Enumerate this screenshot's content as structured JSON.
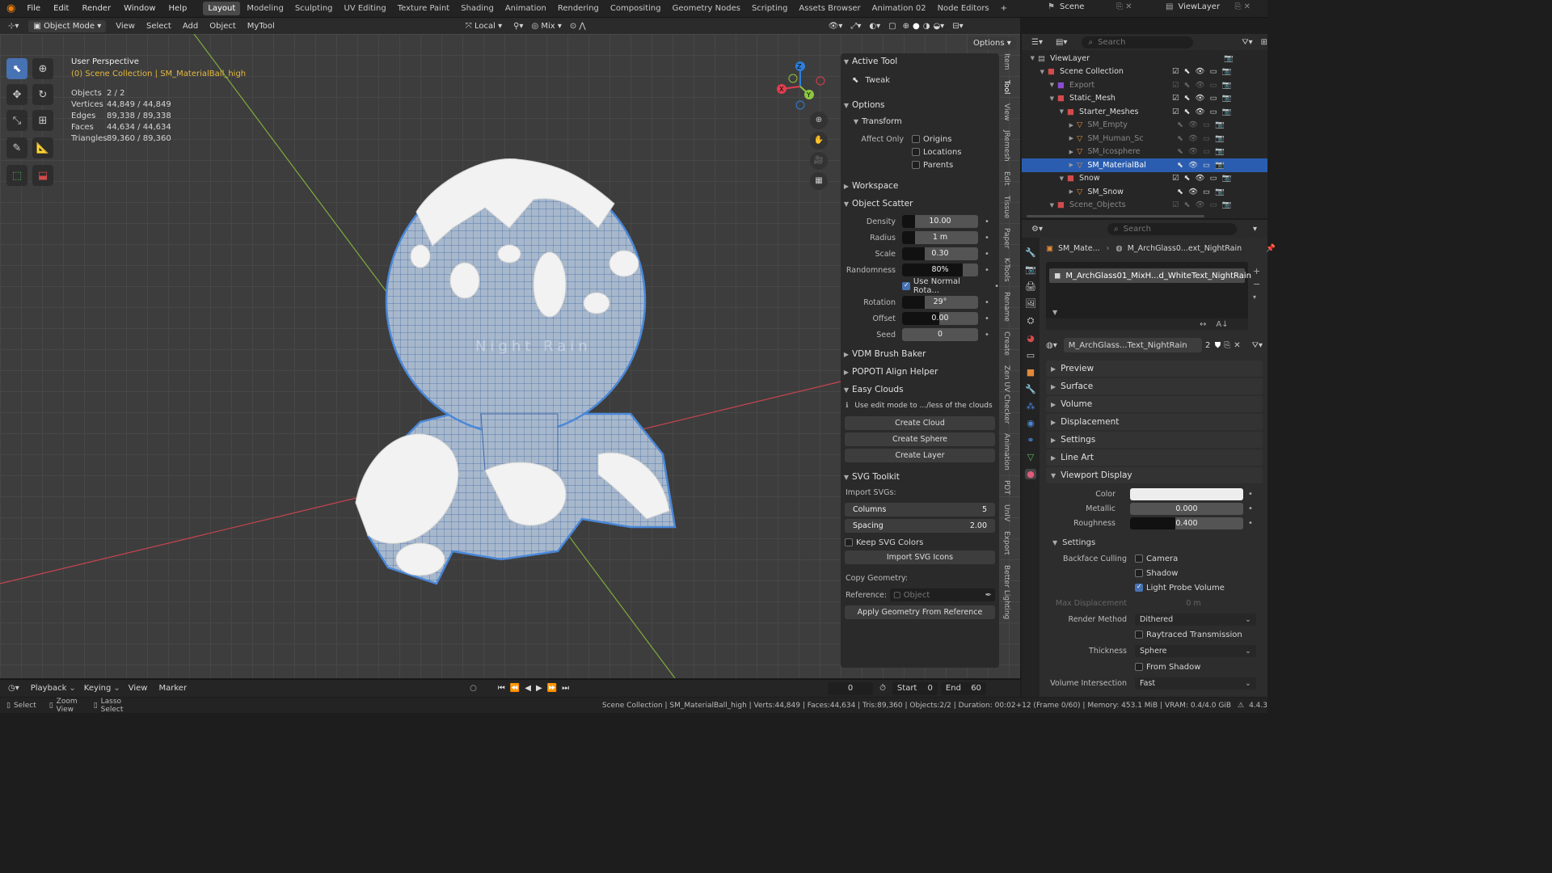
{
  "topbar": {
    "menus": [
      "File",
      "Edit",
      "Render",
      "Window",
      "Help"
    ],
    "workspaces": [
      "Layout",
      "Modeling",
      "Sculpting",
      "UV Editing",
      "Texture Paint",
      "Shading",
      "Animation",
      "Rendering",
      "Compositing",
      "Geometry Nodes",
      "Scripting",
      "Assets Browser",
      "Animation 02",
      "Node Editors"
    ],
    "add_tab": "+",
    "scene": "Scene",
    "view_layer": "ViewLayer"
  },
  "header": {
    "mode": "Object Mode",
    "menus": [
      "View",
      "Select",
      "Add",
      "Object",
      "MyTool"
    ],
    "orientation": "Local",
    "pivot": "Mix",
    "options": "Options"
  },
  "viewport": {
    "title": "User Perspective",
    "subtitle": "(0) Scene Collection | SM_MaterialBall_high",
    "stats": [
      {
        "label": "Objects",
        "value": "2 / 2"
      },
      {
        "label": "Vertices",
        "value": "44,849 / 44,849"
      },
      {
        "label": "Edges",
        "value": "89,338 / 89,338"
      },
      {
        "label": "Faces",
        "value": "44,634 / 44,634"
      },
      {
        "label": "Triangles",
        "value": "89,360 / 89,360"
      }
    ],
    "watermark": "Night Rain",
    "gizmo": {
      "x": "X",
      "y": "Y",
      "z": "Z"
    }
  },
  "npanel": {
    "active_tool": {
      "title": "Active Tool",
      "tool": "Tweak"
    },
    "options": {
      "title": "Options",
      "transform": "Transform",
      "affect_only": "Affect Only",
      "origins": "Origins",
      "locations": "Locations",
      "parents": "Parents"
    },
    "workspace": "Workspace",
    "object_scatter": {
      "title": "Object Scatter",
      "density": {
        "label": "Density",
        "value": "10.00"
      },
      "radius": {
        "label": "Radius",
        "value": "1 m"
      },
      "scale": {
        "label": "Scale",
        "value": "0.30"
      },
      "randomness": {
        "label": "Randomness",
        "value": "80%",
        "fill": 0.8
      },
      "use_normal": "Use Normal Rota...",
      "rotation": {
        "label": "Rotation",
        "value": "29°"
      },
      "offset": {
        "label": "Offset",
        "value": "0.00"
      },
      "seed": {
        "label": "Seed",
        "value": "0"
      }
    },
    "vdm": "VDM Brush Baker",
    "popoti": "POPOTI Align Helper",
    "easy_clouds": {
      "title": "Easy Clouds",
      "hint": "Use edit mode to .../less of the clouds",
      "create_cloud": "Create Cloud",
      "create_sphere": "Create Sphere",
      "create_layer": "Create Layer"
    },
    "svg_toolkit": {
      "title": "SVG Toolkit",
      "import_svgs": "Import SVGs:",
      "columns": {
        "label": "Columns",
        "value": "5"
      },
      "spacing": {
        "label": "Spacing",
        "value": "2.00"
      },
      "keep_colors": "Keep SVG Colors",
      "import_icons": "Import SVG Icons",
      "copy_geometry": "Copy Geometry:",
      "reference": "Reference:",
      "object_placeholder": "Object",
      "apply": "Apply Geometry From Reference"
    },
    "vertical_tabs": [
      "Item",
      "Tool",
      "View",
      "JRemesh",
      "Edit",
      "Tissue",
      "Paper",
      "K-Tools",
      "Rename",
      "Create",
      "Zen UV Checker",
      "Animation",
      "PDT",
      "UnIV",
      "Export",
      "Better Lighting"
    ]
  },
  "outliner": {
    "search_placeholder": "Search",
    "rows": [
      {
        "name": "ViewLayer",
        "indent": 1,
        "icon": "layers-icon",
        "color": "#b0b0b0"
      },
      {
        "name": "Scene Collection",
        "indent": 2,
        "icon": "collection-icon",
        "color": "#d24b4b"
      },
      {
        "name": "Export",
        "indent": 3,
        "icon": "collection-icon",
        "color": "#8a4bd2",
        "dim": true
      },
      {
        "name": "Static_Mesh",
        "indent": 3,
        "icon": "collection-icon",
        "color": "#d24b4b"
      },
      {
        "name": "Starter_Meshes",
        "indent": 4,
        "icon": "collection-icon",
        "color": "#d24b4b"
      },
      {
        "name": "SM_Empty",
        "indent": 5,
        "icon": "mesh-icon",
        "color": "#e08a3a",
        "dim": true
      },
      {
        "name": "SM_Human_Sc",
        "indent": 5,
        "icon": "mesh-icon",
        "color": "#e08a3a",
        "dim": true
      },
      {
        "name": "SM_Icosphere",
        "indent": 5,
        "icon": "mesh-icon",
        "color": "#e08a3a",
        "dim": true
      },
      {
        "name": "SM_MaterialBal",
        "indent": 5,
        "icon": "mesh-icon",
        "color": "#e08a3a",
        "sel": true
      },
      {
        "name": "Snow",
        "indent": 4,
        "icon": "collection-icon",
        "color": "#d24b4b"
      },
      {
        "name": "SM_Snow",
        "indent": 5,
        "icon": "mesh-icon",
        "color": "#e08a3a"
      },
      {
        "name": "Scene_Objects",
        "indent": 3,
        "icon": "collection-icon",
        "color": "#d24b4b",
        "dim": true
      }
    ]
  },
  "properties": {
    "search_placeholder": "Search",
    "breadcrumb_object": "SM_Mate...",
    "breadcrumb_material": "M_ArchGlass0...ext_NightRain",
    "slot": "M_ArchGlass01_MixH...d_WhiteText_NightRain",
    "material_name": "M_ArchGlass...Text_NightRain",
    "users": "2",
    "sections": [
      "Preview",
      "Surface",
      "Volume",
      "Displacement",
      "Settings",
      "Line Art"
    ],
    "viewport_display": {
      "title": "Viewport Display",
      "color_label": "Color",
      "metallic": {
        "label": "Metallic",
        "value": "0.000"
      },
      "roughness": {
        "label": "Roughness",
        "value": "0.400",
        "fill": 0.4
      },
      "settings": "Settings",
      "backface": "Backface Culling",
      "camera": "Camera",
      "shadow": "Shadow",
      "light_probe": "Light Probe Volume",
      "max_disp": {
        "label": "Max Displacement",
        "value": "0 m"
      },
      "render_method": {
        "label": "Render Method",
        "value": "Dithered"
      },
      "raytraced": "Raytraced Transmission",
      "thickness": {
        "label": "Thickness",
        "value": "Sphere"
      },
      "from_shadow": "From Shadow",
      "vol_int": {
        "label": "Volume Intersection",
        "value": "Fast"
      }
    }
  },
  "timeline": {
    "menus": [
      "Playback",
      "Keying",
      "View",
      "Marker"
    ],
    "frame": "0",
    "start_label": "Start",
    "start": "0",
    "end_label": "End",
    "end": "60"
  },
  "status": {
    "select": "Select",
    "zoom": "Zoom View",
    "lasso": "Lasso Select",
    "info": "Scene Collection | SM_MaterialBall_high | Verts:44,849 | Faces:44,634 | Tris:89,360 | Objects:2/2 | Duration: 00:02+12 (Frame 0/60) | Memory: 453.1 MiB | VRAM: 0.4/4.0 GiB",
    "version": "4.4.3"
  },
  "colors": {
    "accent": "#4772b3",
    "selection": "#2a5db0",
    "mesh_wire": "#4a88d8",
    "snow": "#f2f2f2",
    "x_axis": "#e23d4f",
    "y_axis": "#8dc63f",
    "z_axis": "#2f7ed8"
  }
}
